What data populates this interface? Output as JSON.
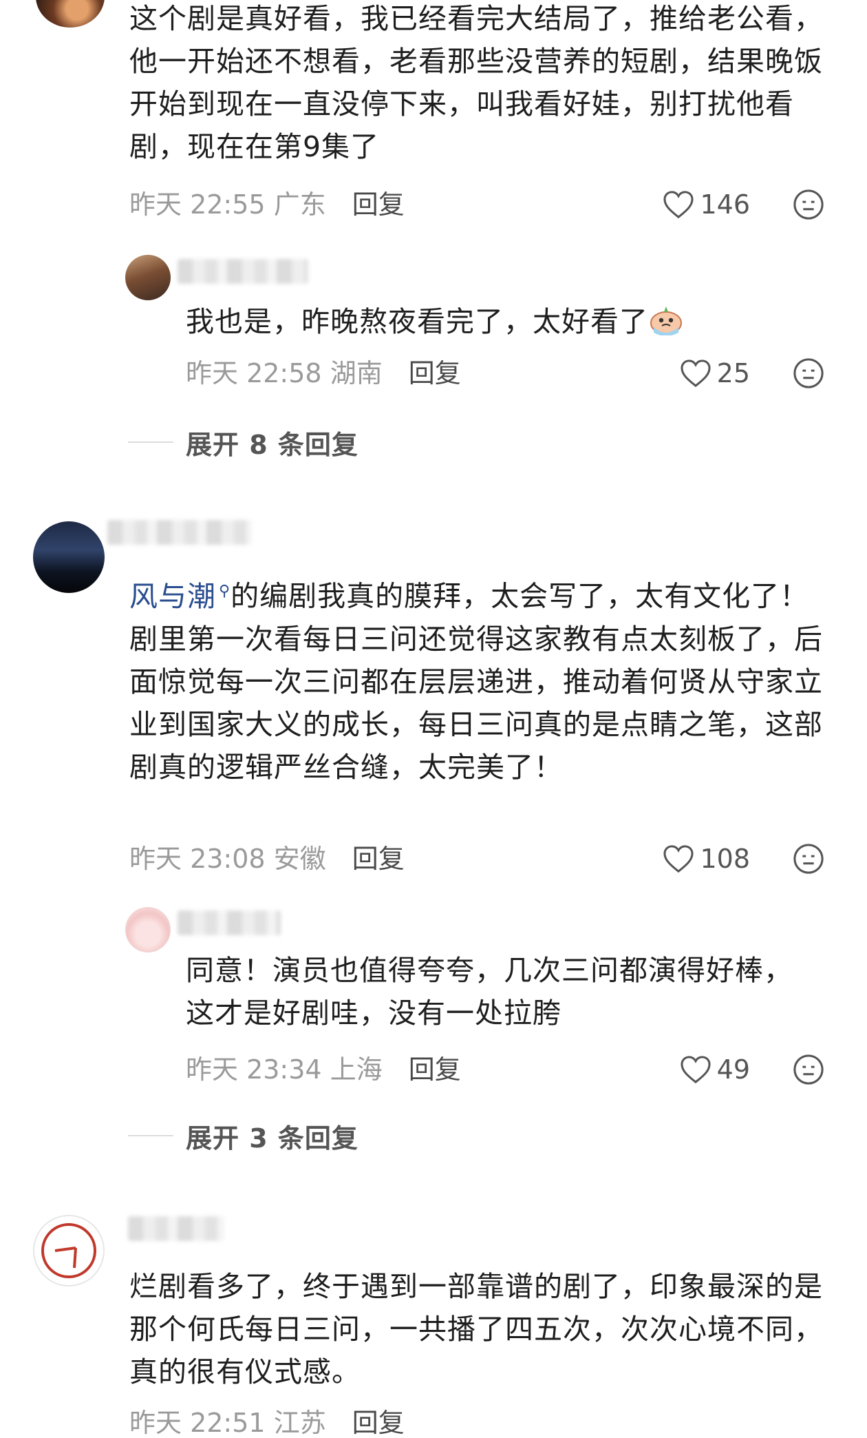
{
  "comments": [
    {
      "text": "这个剧是真好看，我已经看完大结局了，推给老公看，他一开始还不想看，老看那些没营养的短剧，结果晚饭开始到现在一直没停下来，叫我看好娃，别打扰他看剧，现在在第9集了",
      "time": "昨天 22:55",
      "location": "广东",
      "reply_label": "回复",
      "likes": "146"
    },
    {
      "text": "我也是，昨晚熬夜看完了，太好看了",
      "time": "昨天 22:58",
      "location": "湖南",
      "reply_label": "回复",
      "likes": "25"
    },
    {
      "link": "风与潮",
      "text": "的编剧我真的膜拜，太会写了，太有文化了！剧里第一次看每日三问还觉得这家教有点太刻板了，后面惊觉每一次三问都在层层递进，推动着何贤从守家立业到国家大义的成长，每日三问真的是点睛之笔，这部剧真的逻辑严丝合缝，太完美了！",
      "time": "昨天 23:08",
      "location": "安徽",
      "reply_label": "回复",
      "likes": "108"
    },
    {
      "text": "同意！演员也值得夸夸，几次三问都演得好棒，这才是好剧哇，没有一处拉胯",
      "time": "昨天 23:34",
      "location": "上海",
      "reply_label": "回复",
      "likes": "49"
    },
    {
      "text": "烂剧看多了，终于遇到一部靠谱的剧了，印象最深的是那个何氏每日三问，一共播了四五次，次次心境不同，真的很有仪式感。",
      "time": "昨天 22:51",
      "location": "江苏",
      "reply_label": "回复"
    }
  ],
  "expand": [
    {
      "label": "展开 8 条回复"
    },
    {
      "label": "展开 3 条回复"
    }
  ],
  "colors": {
    "link": "#2a4d8f",
    "meta": "#9a9a9a",
    "divider": "#dcdcdc"
  },
  "icons": [
    "heart-icon",
    "dislike-face-icon",
    "search-icon"
  ]
}
